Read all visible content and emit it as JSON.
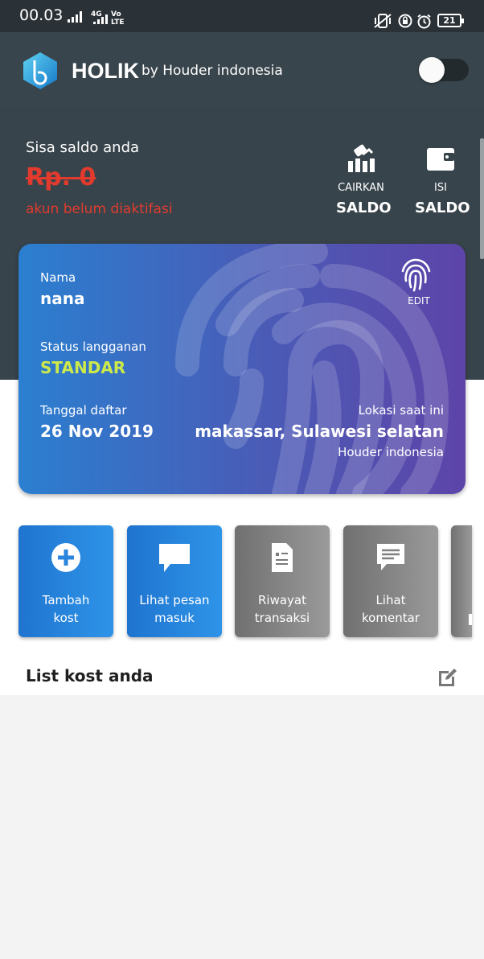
{
  "status_bar": {
    "time": "00.03",
    "network": "4G",
    "volte_top": "Vo",
    "volte_bottom": "LTE",
    "battery": "21"
  },
  "header": {
    "app_name": "HOLIK",
    "subtitle": "by Houder indonesia",
    "toggle_on": false
  },
  "balance": {
    "label": "Sisa saldo anda",
    "value": "Rp. 0",
    "warning": "akun belum diaktifasi"
  },
  "actions": [
    {
      "small": "CAIRKAN",
      "big": "SALDO",
      "icon": "withdraw-icon"
    },
    {
      "small": "ISI",
      "big": "SALDO",
      "icon": "wallet-icon"
    }
  ],
  "card": {
    "name_label": "Nama",
    "name": "nana",
    "status_label": "Status langganan",
    "status": "STANDAR",
    "date_label": "Tanggal daftar",
    "date": "26 Nov 2019",
    "location_label": "Lokasi saat ini",
    "location": "makassar, Sulawesi selatan",
    "company": "Houder indonesia",
    "edit_label": "EDIT"
  },
  "menu": [
    {
      "line1": "Tambah",
      "line2": "kost",
      "icon": "plus-icon",
      "color": "blue"
    },
    {
      "line1": "Lihat pesan",
      "line2": "masuk",
      "icon": "message-icon",
      "color": "blue"
    },
    {
      "line1": "Riwayat",
      "line2": "transaksi",
      "icon": "document-icon",
      "color": "gray"
    },
    {
      "line1": "Lihat",
      "line2": "komentar",
      "icon": "comment-icon",
      "color": "gray"
    }
  ],
  "list": {
    "title": "List kost anda"
  },
  "colors": {
    "header": "#39454c",
    "accent_red": "#e23b2e",
    "status_yellow": "#cde94a",
    "blue": "#1f74cf"
  }
}
